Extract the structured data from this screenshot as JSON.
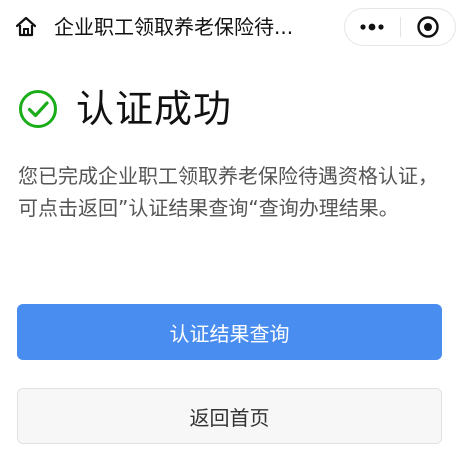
{
  "navbar": {
    "title": "企业职工领取养老保险待...",
    "home_icon": "home-icon",
    "more_icon": "more-dots-icon",
    "close_icon": "target-circle-icon"
  },
  "result": {
    "icon": "check-circle-icon",
    "icon_color": "#1aad19",
    "title": "认证成功",
    "description": "您已完成企业职工领取养老保险待遇资格认证，可点击返回”认证结果查询“查询办理结果。"
  },
  "actions": {
    "primary_label": "认证结果查询",
    "primary_color": "#4a8df0",
    "secondary_label": "返回首页"
  }
}
